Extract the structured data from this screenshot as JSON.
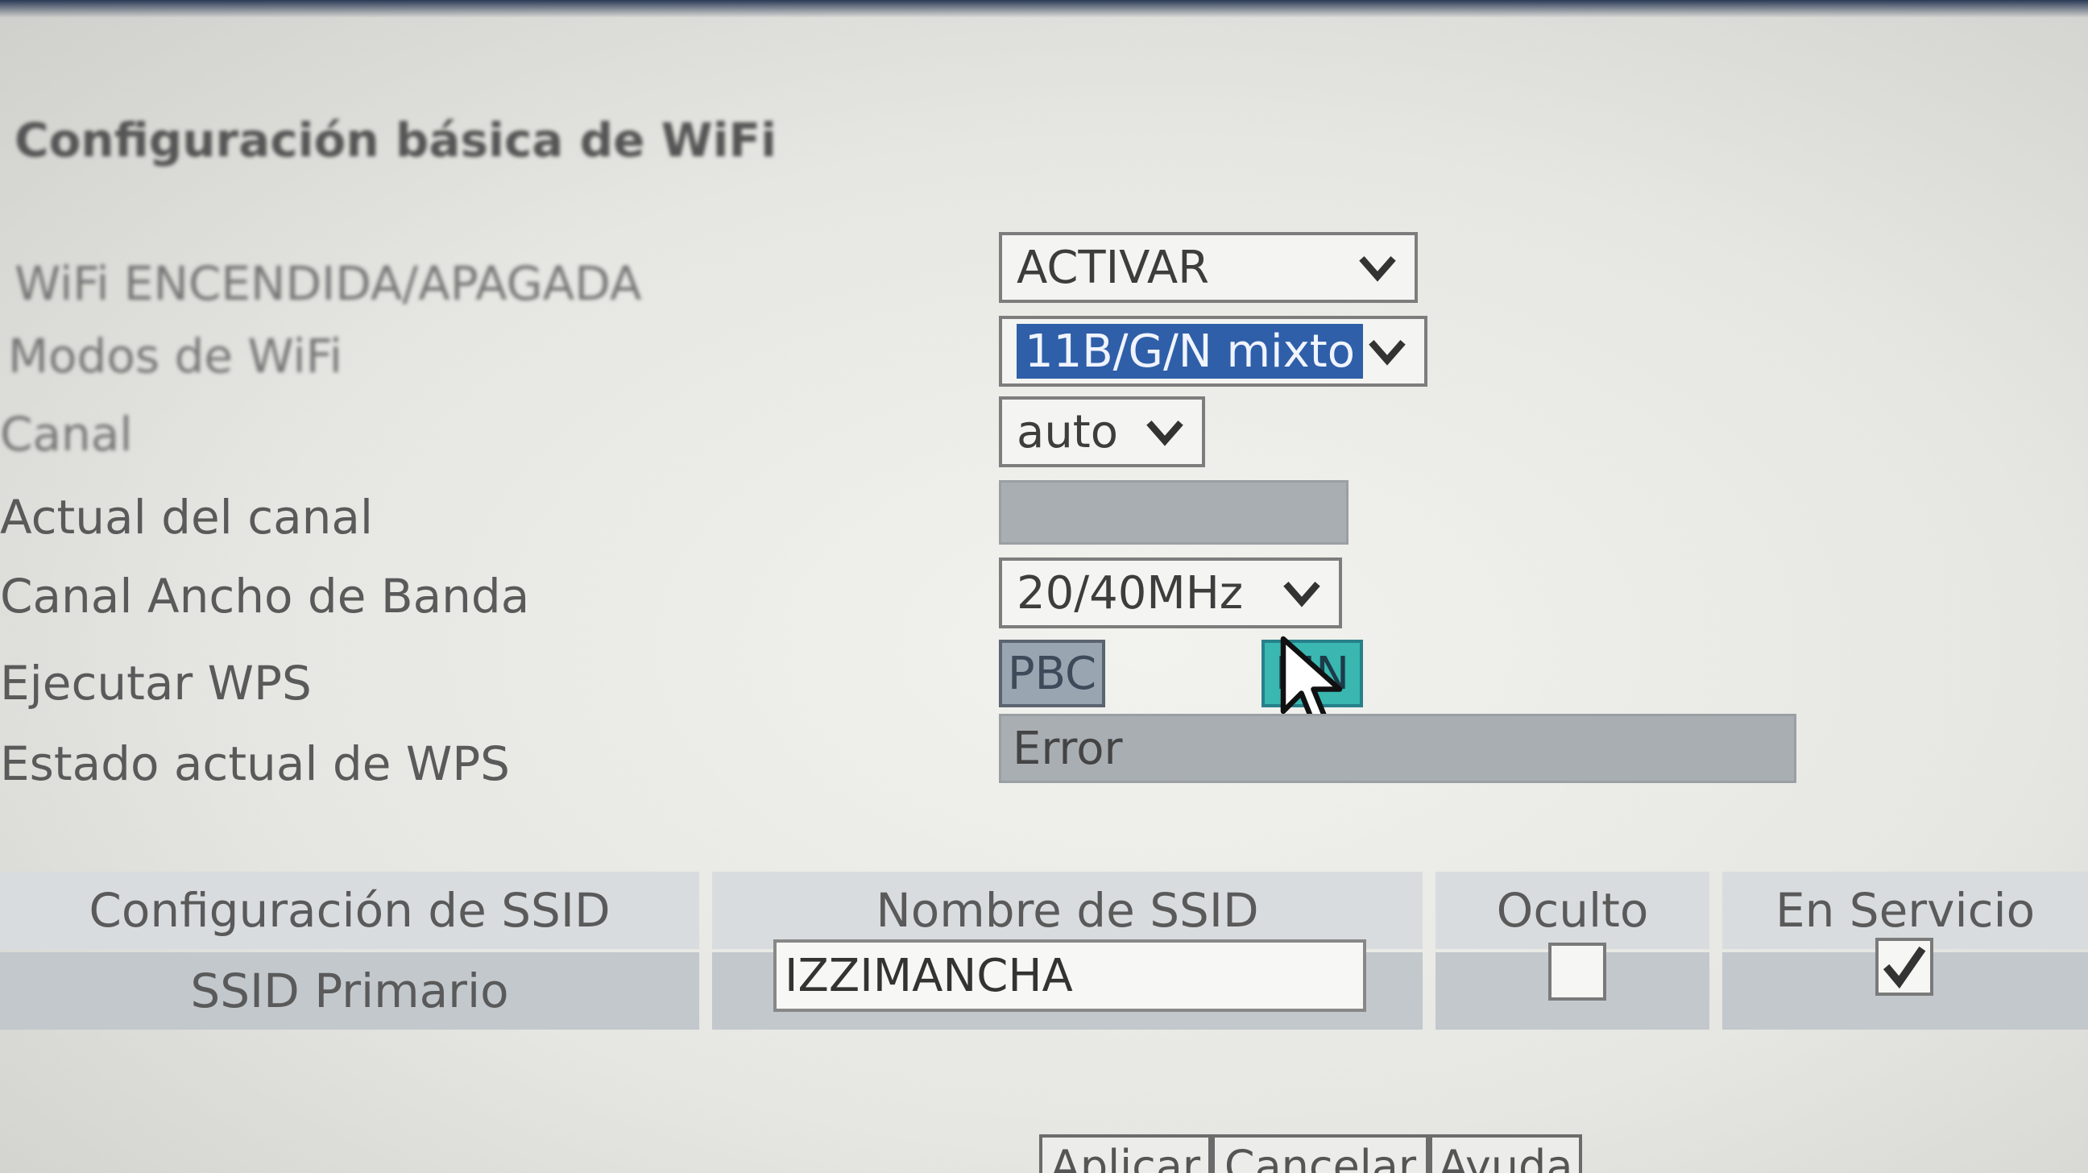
{
  "section": {
    "title": "Configuración básica de WiFi"
  },
  "form": {
    "wifi_onoff": {
      "label": "WiFi ENCENDIDA/APAGADA",
      "value": "ACTIVAR"
    },
    "wifi_mode": {
      "label": "Modos de WiFi",
      "value": "11B/G/N mixto"
    },
    "channel": {
      "label": "Canal",
      "value": "auto"
    },
    "current_channel": {
      "label": "Actual del canal",
      "value": ""
    },
    "bandwidth": {
      "label": "Canal Ancho de Banda",
      "value": "20/40MHz"
    },
    "wps_run": {
      "label": "Ejecutar WPS",
      "pbc_label": "PBC",
      "pin_label": "PIN"
    },
    "wps_status": {
      "label": "Estado actual de WPS",
      "value": "Error"
    }
  },
  "ssid_table": {
    "headers": [
      "Configuración de SSID",
      "Nombre de SSID",
      "Oculto",
      "En Servicio"
    ],
    "rows": [
      {
        "config": "SSID Primario",
        "name": "IZZIMANCHA",
        "hidden": false,
        "in_service": true
      }
    ]
  },
  "footer": {
    "apply": "Aplicar",
    "cancel": "Cancelar",
    "help": "Ayuda"
  },
  "colors": {
    "selection": "#2f5fa8",
    "pin_button": "#39b7b0",
    "readonly": "#a9aeb3"
  }
}
